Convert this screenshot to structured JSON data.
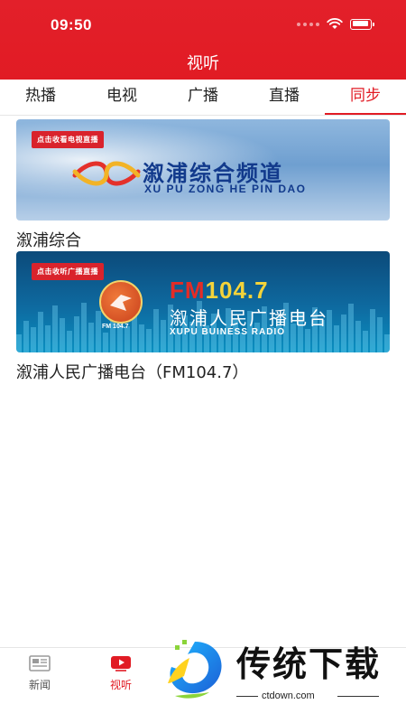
{
  "status_bar": {
    "time": "09:50"
  },
  "header": {
    "title": "视听"
  },
  "tabs": [
    {
      "label": "热播",
      "active": false
    },
    {
      "label": "电视",
      "active": false
    },
    {
      "label": "广播",
      "active": false
    },
    {
      "label": "直播",
      "active": false
    },
    {
      "label": "同步",
      "active": true
    }
  ],
  "channels": [
    {
      "banner_badge": "点击收看电视直播",
      "banner_title": "溆浦综合频道",
      "banner_subtitle": "XU PU ZONG HE PIN DAO",
      "name": "溆浦综合"
    },
    {
      "banner_badge": "点击收听广播直播",
      "banner_title_fm": "FM",
      "banner_title_freq": "104.7",
      "banner_logo_text": "FM 104.7",
      "banner_title": "溆浦人民广播电台",
      "banner_subtitle": "XUPU BUINESS RADIO",
      "name": "溆浦人民广播电台（FM104.7）"
    }
  ],
  "bottom_nav": [
    {
      "label": "新闻",
      "icon": "newspaper-icon",
      "active": false
    },
    {
      "label": "视听",
      "icon": "video-play-icon",
      "active": true
    }
  ],
  "watermark": {
    "brand": "传统下载",
    "url": "ctdown.com"
  },
  "colors": {
    "accent": "#e11b24",
    "text": "#222222"
  }
}
